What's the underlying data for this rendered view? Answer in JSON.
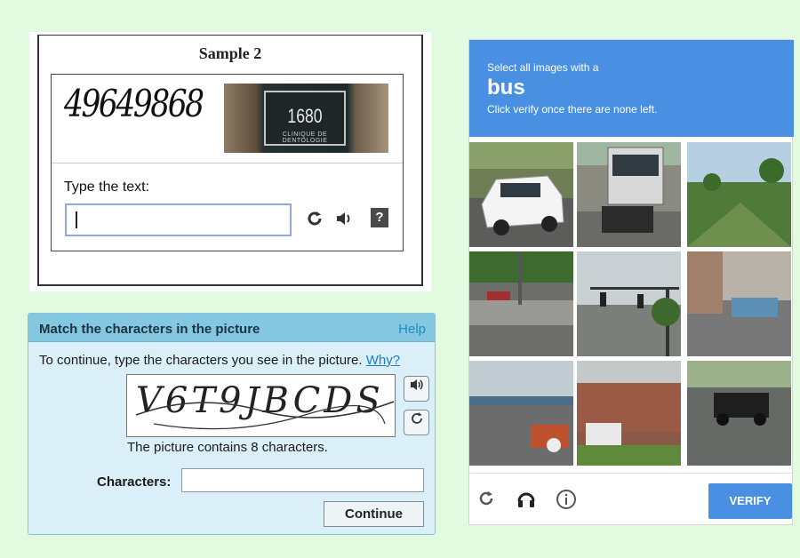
{
  "sample2": {
    "title": "Sample 2",
    "captcha_word": "49649868",
    "house_number": "1680",
    "house_sub": "CLINIQUE DE DENTOLOGIE",
    "prompt": "Type the text:",
    "reload_icon": "reload-icon",
    "audio_icon": "audio-icon",
    "help_label": "?"
  },
  "match": {
    "title": "Match the characters in the picture",
    "help_link": "Help",
    "instruction": "To continue, type the characters you see in the picture.",
    "why_link": "Why?",
    "captcha_text": "V6T9JBCDS",
    "audio_icon": "speaker-icon",
    "refresh_icon": "refresh-icon",
    "count_text": "The picture contains 8 characters.",
    "field_label": "Characters:",
    "field_value": "",
    "continue_label": "Continue"
  },
  "grid": {
    "prompt_line1": "Select all images with a",
    "target_word": "bus",
    "prompt_line3": "Click verify once there are none left.",
    "tiles": [
      "white minivan on road",
      "city bus on street",
      "grass field with trees",
      "highway with barrier",
      "traffic light intersection",
      "street with bus",
      "bus station",
      "house with stairs",
      "highway with black suv"
    ],
    "footer": {
      "reload_icon": "reload-icon",
      "audio_icon": "headphones-icon",
      "info_icon": "info-icon",
      "verify_label": "VERIFY"
    }
  }
}
